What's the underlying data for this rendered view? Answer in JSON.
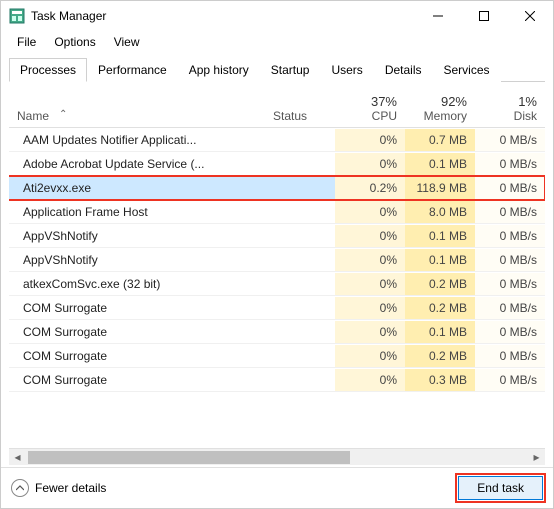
{
  "window": {
    "title": "Task Manager"
  },
  "menu": [
    "File",
    "Options",
    "View"
  ],
  "tabs": [
    "Processes",
    "Performance",
    "App history",
    "Startup",
    "Users",
    "Details",
    "Services"
  ],
  "active_tab": 0,
  "columns": {
    "name": "Name",
    "status": "Status",
    "cpu": {
      "pct": "37%",
      "label": "CPU"
    },
    "memory": {
      "pct": "92%",
      "label": "Memory"
    },
    "disk": {
      "pct": "1%",
      "label": "Disk"
    }
  },
  "processes": [
    {
      "name": "AAM Updates Notifier Applicati...",
      "cpu": "0%",
      "mem": "0.7 MB",
      "disk": "0 MB/s"
    },
    {
      "name": "Adobe Acrobat Update Service (...",
      "cpu": "0%",
      "mem": "0.1 MB",
      "disk": "0 MB/s"
    },
    {
      "name": "Ati2evxx.exe",
      "cpu": "0.2%",
      "mem": "118.9 MB",
      "disk": "0 MB/s",
      "selected": true,
      "highlight": true
    },
    {
      "name": "Application Frame Host",
      "cpu": "0%",
      "mem": "8.0 MB",
      "disk": "0 MB/s"
    },
    {
      "name": "AppVShNotify",
      "cpu": "0%",
      "mem": "0.1 MB",
      "disk": "0 MB/s"
    },
    {
      "name": "AppVShNotify",
      "cpu": "0%",
      "mem": "0.1 MB",
      "disk": "0 MB/s"
    },
    {
      "name": "atkexComSvc.exe (32 bit)",
      "cpu": "0%",
      "mem": "0.2 MB",
      "disk": "0 MB/s"
    },
    {
      "name": "COM Surrogate",
      "cpu": "0%",
      "mem": "0.2 MB",
      "disk": "0 MB/s"
    },
    {
      "name": "COM Surrogate",
      "cpu": "0%",
      "mem": "0.1 MB",
      "disk": "0 MB/s"
    },
    {
      "name": "COM Surrogate",
      "cpu": "0%",
      "mem": "0.2 MB",
      "disk": "0 MB/s"
    },
    {
      "name": "COM Surrogate",
      "cpu": "0%",
      "mem": "0.3 MB",
      "disk": "0 MB/s"
    }
  ],
  "footer": {
    "fewer": "Fewer details",
    "end": "End task"
  }
}
